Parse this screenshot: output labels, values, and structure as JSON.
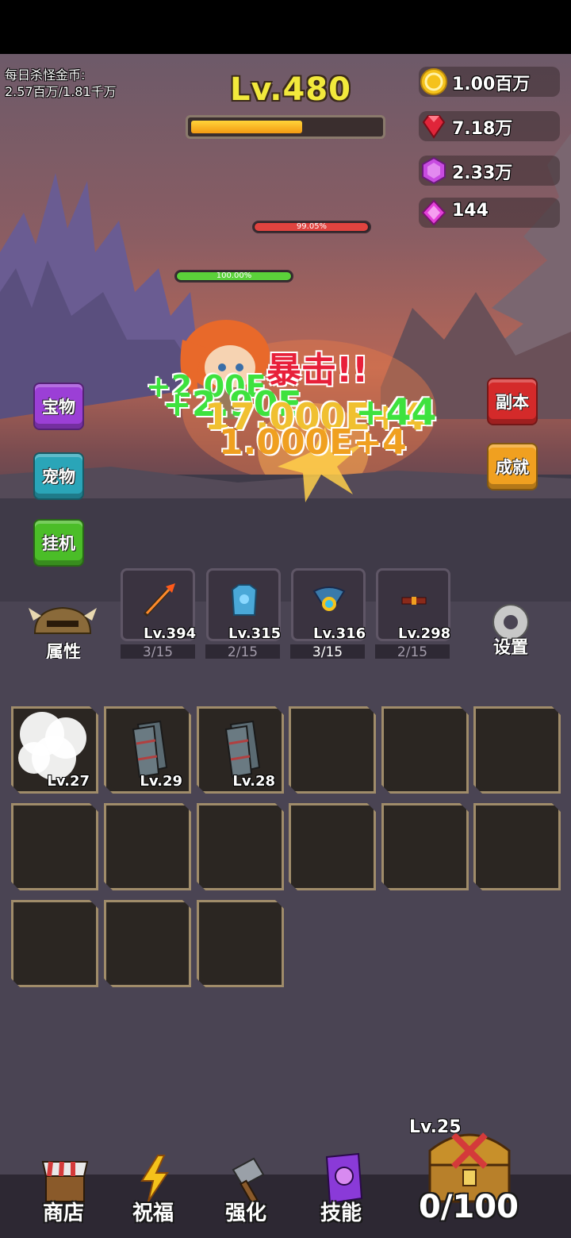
{
  "hud": {
    "daily_gold_label": "每日杀怪金币:",
    "daily_gold_value": "2.57百万/1.81千万",
    "level": "Lv.480",
    "xp_fraction": 0.59
  },
  "currencies": [
    {
      "name": "gold-coin-icon",
      "value": "1.00百万",
      "color": "#f5c21b"
    },
    {
      "name": "ruby-icon",
      "value": "7.18万",
      "color": "#e0253a"
    },
    {
      "name": "purple-gem-icon",
      "value": "2.33万",
      "color": "#c74be0"
    },
    {
      "name": "diamond-icon",
      "value": "144",
      "color": "#e33fd8"
    }
  ],
  "battle": {
    "enemy_hp_text": "99.05%",
    "enemy_hp_fraction": 0.9905,
    "player_hp_text": "100.00%",
    "player_hp_fraction": 1.0,
    "crit_text": "暴击!!",
    "damage_numbers": [
      "+2.00E",
      "+2.90E",
      "17.000E+4",
      "1.000E+4",
      "+44"
    ]
  },
  "left_menu": [
    "宝物",
    "宠物",
    "挂机"
  ],
  "right_menu": [
    "副本",
    "成就"
  ],
  "equipment": {
    "attributes_label": "属性",
    "settings_label": "设置",
    "slots": [
      {
        "name": "weapon",
        "level": "Lv.394",
        "count": "3/15"
      },
      {
        "name": "armor",
        "level": "Lv.315",
        "count": "2/15"
      },
      {
        "name": "amulet",
        "level": "Lv.316",
        "count": "3/15"
      },
      {
        "name": "belt",
        "level": "Lv.298",
        "count": "2/15"
      }
    ]
  },
  "bag": {
    "items": [
      {
        "level": "Lv.27"
      },
      {
        "level": "Lv.29"
      },
      {
        "level": "Lv.28"
      }
    ]
  },
  "bottom_nav": [
    "商店",
    "祝福",
    "强化",
    "技能"
  ],
  "chest": {
    "level": "Lv.25",
    "count": "0/100"
  }
}
